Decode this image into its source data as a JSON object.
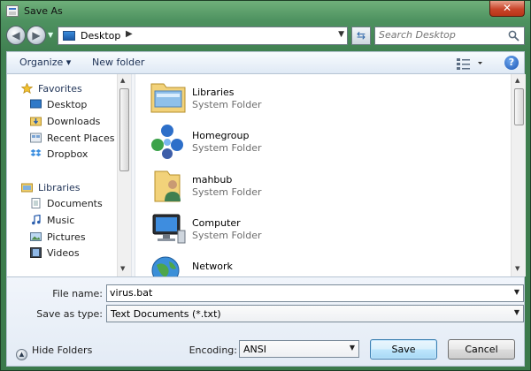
{
  "window": {
    "title": "Save As",
    "close_label": "✕"
  },
  "navigation": {
    "address": "Desktop",
    "search_placeholder": "Search Desktop"
  },
  "toolbar": {
    "organize_label": "Organize ▾",
    "new_folder_label": "New folder",
    "help_label": "?"
  },
  "nav_pane": {
    "favorites_label": "Favorites",
    "favorites": [
      "Desktop",
      "Downloads",
      "Recent Places",
      "Dropbox"
    ],
    "libraries_label": "Libraries",
    "libraries": [
      "Documents",
      "Music",
      "Pictures",
      "Videos"
    ]
  },
  "files": [
    {
      "name": "Libraries",
      "type": "System Folder",
      "icon": "libraries-icon"
    },
    {
      "name": "Homegroup",
      "type": "System Folder",
      "icon": "homegroup-icon"
    },
    {
      "name": "mahbub",
      "type": "System Folder",
      "icon": "user-folder-icon"
    },
    {
      "name": "Computer",
      "type": "System Folder",
      "icon": "computer-icon"
    },
    {
      "name": "Network",
      "type": "",
      "icon": "network-icon"
    }
  ],
  "form": {
    "file_name_label": "File name:",
    "file_name_value": "virus.bat",
    "save_type_label": "Save as type:",
    "save_type_value": "Text Documents (*.txt)",
    "encoding_label": "Encoding:",
    "encoding_value": "ANSI"
  },
  "footer": {
    "hide_folders_label": "Hide Folders",
    "save_label": "Save",
    "cancel_label": "Cancel"
  },
  "colors": {
    "accent": "#1e3256",
    "window_frame": "#3f7f50"
  }
}
